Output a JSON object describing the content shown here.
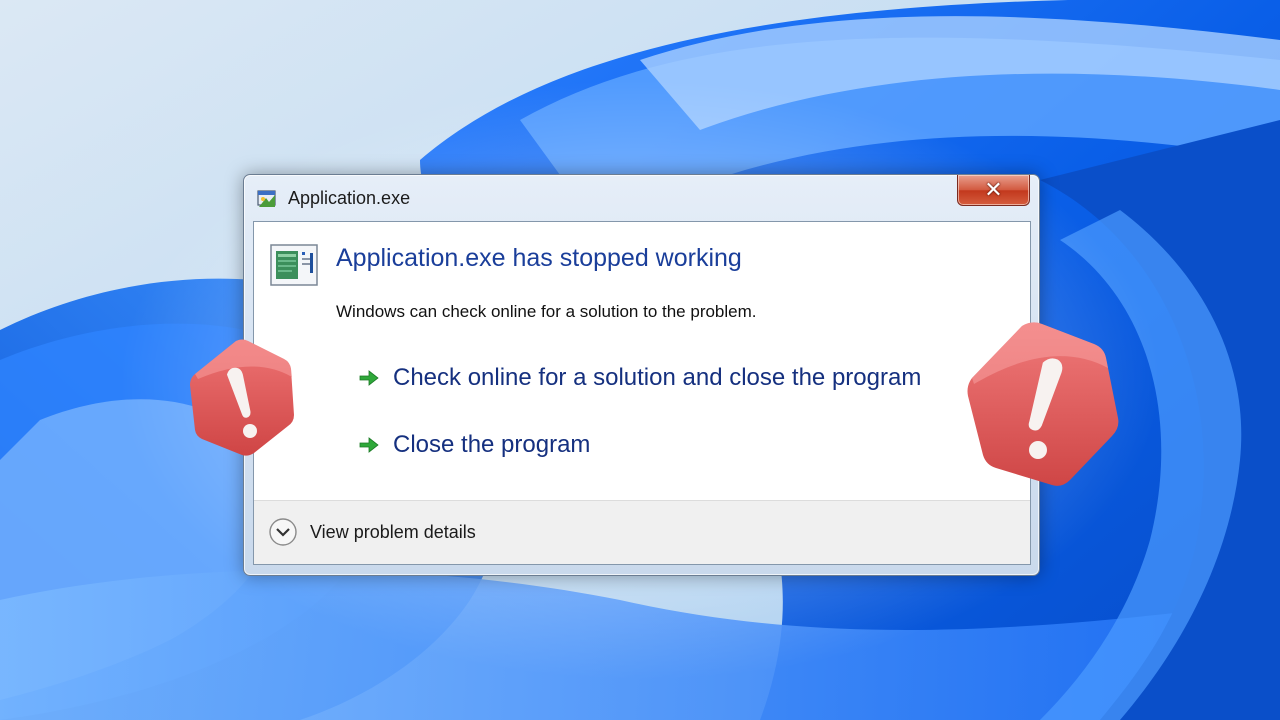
{
  "window": {
    "title": "Application.exe",
    "close_glyph": "✕"
  },
  "dialog": {
    "main_instruction": "Application.exe has stopped working",
    "content": "Windows can check online for a solution to the problem.",
    "commands": [
      {
        "label": "Check online for a solution and close the program"
      },
      {
        "label": "Close the program"
      }
    ],
    "expando_label": "View problem details"
  },
  "icons": {
    "title": "application-exe-icon",
    "app": "program-window-icon",
    "command": "green-arrow-icon",
    "expando": "chevron-down-circle-icon",
    "warning": "warning-exclamation-icon"
  },
  "colors": {
    "instruction": "#1a3e9a",
    "command_link": "#15307f",
    "arrow": "#2fa83a",
    "warning_badge": "#e05c5c",
    "close_button": "#c9442a"
  }
}
